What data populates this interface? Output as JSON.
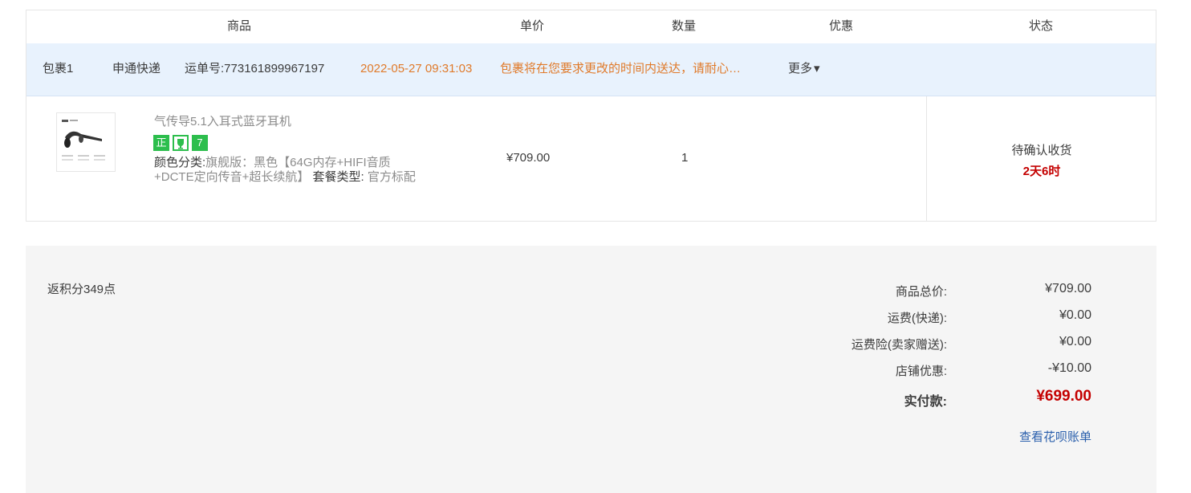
{
  "columns": {
    "product": "商品",
    "unit_price": "单价",
    "quantity": "数量",
    "discount": "优惠",
    "status": "状态"
  },
  "package": {
    "name": "包裹1",
    "carrier": "申通快递",
    "tracking": "运单号:773161899967197",
    "time": "2022-05-27 09:31:03",
    "message": "包裹将在您要求更改的时间内送达，请耐心…",
    "more": "更多"
  },
  "item": {
    "title": "气传导5.1入耳式蓝牙耳机",
    "badges": [
      "正",
      "",
      "7"
    ],
    "sku_label1": "颜色分类:",
    "sku_value1": "旗舰版：黑色【64G内存+HIFI音质+DCTE定向传音+超长续航】",
    "sku_label2": "套餐类型:",
    "sku_value2": "官方标配",
    "price": "¥709.00",
    "qty": "1",
    "status": "待确认收货",
    "countdown": "2天6时"
  },
  "summary": {
    "points": "返积分349点",
    "rows": [
      {
        "label": "商品总价:",
        "value": "¥709.00"
      },
      {
        "label": "运费(快递):",
        "value": "¥0.00"
      },
      {
        "label": "运费险(卖家赠送):",
        "value": "¥0.00"
      },
      {
        "label": "店铺优惠:",
        "value": "-¥10.00"
      }
    ],
    "paid_label": "实付款:",
    "paid_value": "¥699.00",
    "huabei_link": "查看花呗账单"
  },
  "colors": {
    "accent_orange": "#e07a2a",
    "price_red": "#c40000",
    "link_blue": "#2a5fac",
    "badge_green": "#2dbe4d",
    "package_bar_bg": "#e8f2fd"
  }
}
